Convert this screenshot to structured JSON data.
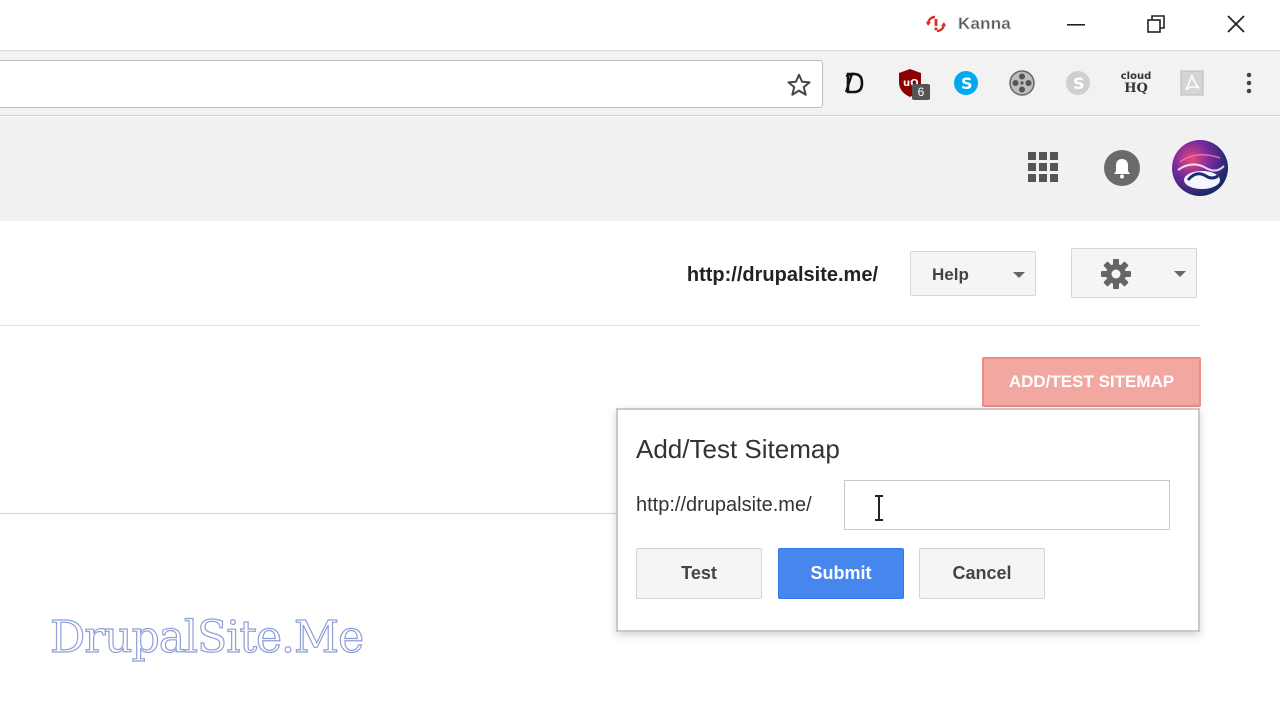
{
  "window": {
    "user_name": "Kanna",
    "controls": [
      "minimize",
      "restore",
      "close"
    ]
  },
  "toolbar": {
    "bookmark_icon": "star-icon",
    "extensions": [
      {
        "name": "dashlane-icon"
      },
      {
        "name": "ublock-icon",
        "badge": "6"
      },
      {
        "name": "skype-icon"
      },
      {
        "name": "film-reel-icon"
      },
      {
        "name": "skype-grey-icon"
      },
      {
        "name": "cloudhq-icon",
        "line1": "cloud",
        "line2": "HQ"
      },
      {
        "name": "pdf-icon"
      }
    ],
    "menu_icon": "kebab-menu-icon"
  },
  "appbar": {
    "apps_icon": "apps-grid-icon",
    "notifications_icon": "bell-icon",
    "avatar": "user-avatar"
  },
  "content": {
    "site_url": "http://drupalsite.me/",
    "help_label": "Help",
    "settings_icon": "gear-icon",
    "add_test_sitemap_label": "ADD/TEST SITEMAP"
  },
  "dialog": {
    "title": "Add/Test Sitemap",
    "url_prefix": "http://drupalsite.me/",
    "input_value": "",
    "test_label": "Test",
    "submit_label": "Submit",
    "cancel_label": "Cancel"
  },
  "watermark": "DrupalSite.Me",
  "colors": {
    "primary_blue": "#4787ed",
    "add_sitemap_red": "#f2a7a0",
    "appbar_grey": "#f1f1f1"
  }
}
